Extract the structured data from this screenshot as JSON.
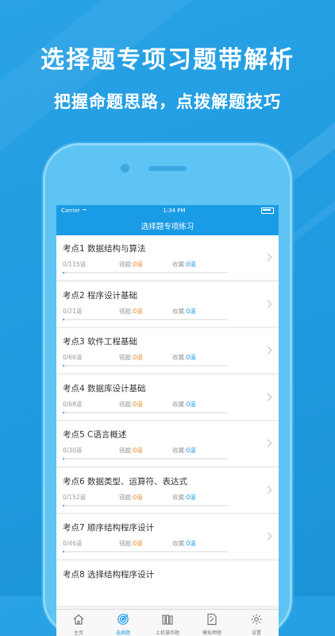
{
  "promo": {
    "headline": "选择题专项习题带解析",
    "subline": "把握命题思路，点拨解题技巧"
  },
  "status_bar": {
    "carrier": "Carrier",
    "time": "1:34 PM"
  },
  "nav": {
    "title": "选择题专项练习"
  },
  "items": [
    {
      "title": "考点1 数据结构与算法",
      "progress_text": "0/115道",
      "error_label": "错题:",
      "error_value": "0道",
      "fav_label": "收藏:",
      "fav_value": "0道",
      "progress": 0.01
    },
    {
      "title": "考点2 程序设计基础",
      "progress_text": "0/21道",
      "error_label": "错题:",
      "error_value": "0道",
      "fav_label": "收藏:",
      "fav_value": "0道",
      "progress": 0.01
    },
    {
      "title": "考点3 软件工程基础",
      "progress_text": "0/66道",
      "error_label": "错题:",
      "error_value": "0道",
      "fav_label": "收藏:",
      "fav_value": "0道",
      "progress": 0.01
    },
    {
      "title": "考点4 数据库设计基础",
      "progress_text": "0/68道",
      "error_label": "错题:",
      "error_value": "0道",
      "fav_label": "收藏:",
      "fav_value": "0道",
      "progress": 0.01
    },
    {
      "title": "考点5 C语言概述",
      "progress_text": "0/30道",
      "error_label": "错题:",
      "error_value": "0道",
      "fav_label": "收藏:",
      "fav_value": "0道",
      "progress": 0.01
    },
    {
      "title": "考点6 数据类型、运算符、表达式",
      "progress_text": "0/152道",
      "error_label": "错题:",
      "error_value": "0道",
      "fav_label": "收藏:",
      "fav_value": "0道",
      "progress": 0.01
    },
    {
      "title": "考点7 顺序结构程序设计",
      "progress_text": "0/46道",
      "error_label": "错题:",
      "error_value": "0道",
      "fav_label": "收藏:",
      "fav_value": "0道",
      "progress": 0.01
    },
    {
      "title": "考点8 选择结构程序设计",
      "progress_text": "",
      "error_label": "",
      "error_value": "",
      "fav_label": "",
      "fav_value": "",
      "progress": 0
    }
  ],
  "tabs": [
    {
      "label": "主页",
      "icon": "home-icon",
      "active": false
    },
    {
      "label": "选择题",
      "icon": "target-icon",
      "active": true
    },
    {
      "label": "上机操作题",
      "icon": "books-icon",
      "active": false
    },
    {
      "label": "模拟押题",
      "icon": "document-edit-icon",
      "active": false
    },
    {
      "label": "设置",
      "icon": "gear-icon",
      "active": false
    }
  ],
  "colors": {
    "brand": "#1a9be6",
    "error": "#f08a24"
  }
}
